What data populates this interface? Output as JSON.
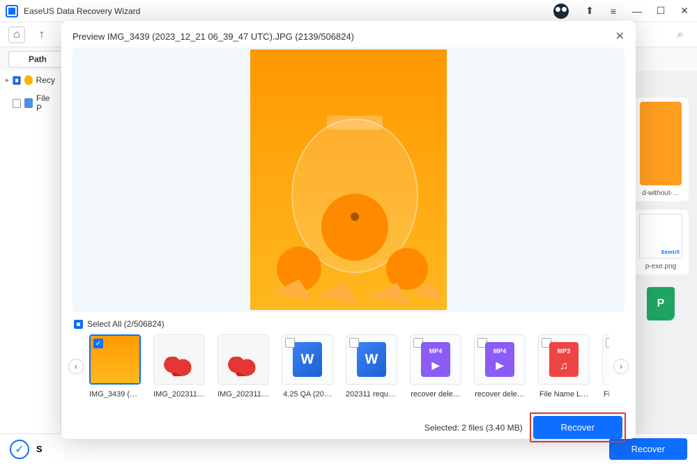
{
  "app": {
    "title": "EaseUS Data Recovery Wizard"
  },
  "toolbar": {
    "path_label": "Path"
  },
  "sidebar": {
    "items": [
      {
        "label": "Recy"
      },
      {
        "label": "File P"
      }
    ]
  },
  "bgcards": {
    "card1": "d-without-…",
    "card2": "p-exe.png"
  },
  "taskbar": {
    "status_prefix": "S",
    "bottom_recover": "Recover"
  },
  "modal": {
    "title": "Preview IMG_3439 (2023_12_21 06_39_47 UTC).JPG (2139/506824)",
    "select_all": "Select All (2/506824)",
    "thumbs": [
      {
        "caption": "IMG_3439 (2…",
        "type": "orange",
        "selected": true,
        "checked": true
      },
      {
        "caption": "IMG_202311…",
        "type": "tom",
        "selected": false,
        "checked": false
      },
      {
        "caption": "IMG_202311…",
        "type": "tom",
        "selected": false,
        "checked": false
      },
      {
        "caption": "4.25 QA (20…",
        "type": "w",
        "selected": false,
        "checked": false
      },
      {
        "caption": "202311 requi…",
        "type": "w",
        "selected": false,
        "checked": false
      },
      {
        "caption": "recover dele…",
        "type": "mp4",
        "selected": false,
        "checked": false
      },
      {
        "caption": "recover dele…",
        "type": "mp4",
        "selected": false,
        "checked": false
      },
      {
        "caption": "File Name L…",
        "type": "mp3",
        "selected": false,
        "checked": false
      },
      {
        "caption": "File Name L…",
        "type": "mp3",
        "selected": false,
        "checked": false
      }
    ],
    "footer_text": "Selected: 2 files (3.40 MB)",
    "recover": "Recover"
  }
}
